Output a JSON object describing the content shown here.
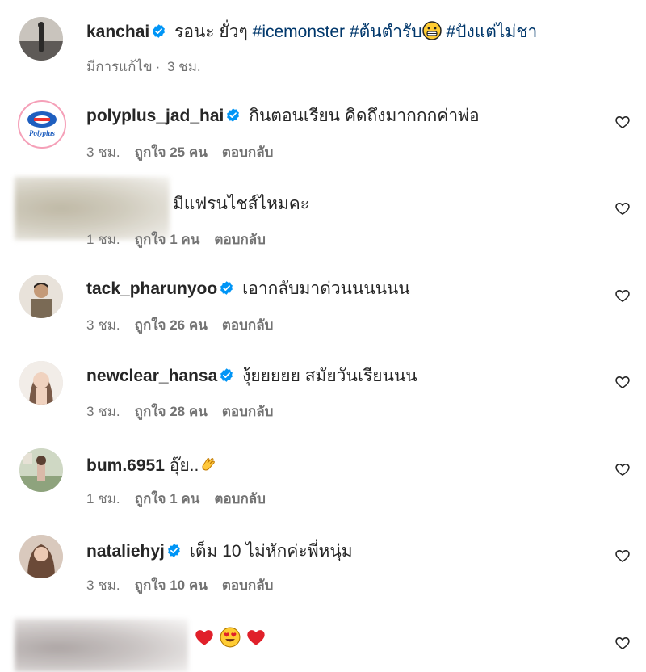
{
  "caption": {
    "username": "kanchai",
    "text": "รอนะ ยั่วๆ",
    "hashtags": [
      "#icemonster",
      "#ต้นตำรับ",
      "#ปังแต่ไม่ชา"
    ],
    "edited": "มีการแก้ไข",
    "time": "3 ชม."
  },
  "comments": [
    {
      "username": "polyplus_jad_hai",
      "verified": true,
      "text": "กินตอนเรียน คิดถึงมากกกค่าพ่อ",
      "time": "3 ชม.",
      "likes": "ถูกใจ 25 คน",
      "reply": "ตอบกลับ"
    },
    {
      "username": "",
      "verified": false,
      "text": "มีแฟรนไชส์ไหมคะ",
      "time": "1 ชม.",
      "likes": "ถูกใจ 1 คน",
      "reply": "ตอบกลับ"
    },
    {
      "username": "tack_pharunyoo",
      "verified": true,
      "text": "เอากลับมาด่วนนนนนน",
      "time": "3 ชม.",
      "likes": "ถูกใจ 26 คน",
      "reply": "ตอบกลับ"
    },
    {
      "username": "newclear_hansa",
      "verified": true,
      "text": "งุ้ยยยยย สมัยวันเรียนนน",
      "time": "3 ชม.",
      "likes": "ถูกใจ 28 คน",
      "reply": "ตอบกลับ"
    },
    {
      "username": "bum.6951",
      "verified": false,
      "text": "อุ๊ย..",
      "time": "1 ชม.",
      "likes": "ถูกใจ 1 คน",
      "reply": "ตอบกลับ"
    },
    {
      "username": "nataliehyj",
      "verified": true,
      "text": "เต็ม 10 ไม่หักค่ะพี่หนุ่ม",
      "time": "3 ชม.",
      "likes": "ถูกใจ 10 คน",
      "reply": "ตอบกลับ"
    },
    {
      "username": "",
      "verified": false,
      "text": "",
      "time": "",
      "likes": "",
      "reply": ""
    }
  ],
  "colors": {
    "verified": "#0095f6",
    "hashtag": "#00376b",
    "meta": "#737373",
    "text": "#262626"
  },
  "icons": {
    "like": "heart-outline-icon",
    "verified": "verified-badge-icon"
  }
}
